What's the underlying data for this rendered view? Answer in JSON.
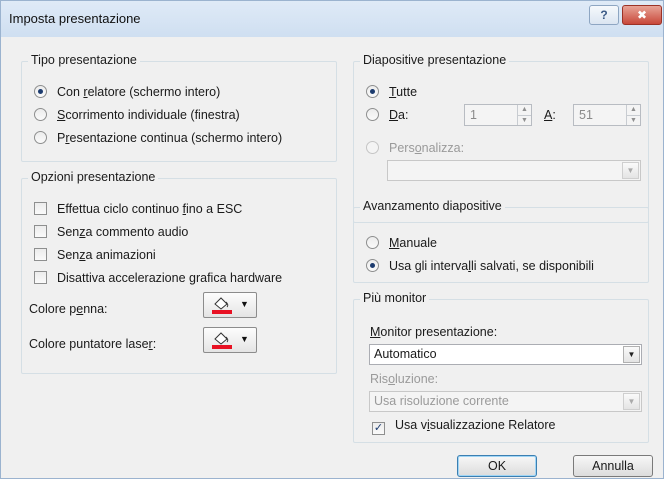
{
  "window": {
    "title": "Imposta presentazione",
    "help_glyph": "?",
    "close_glyph": "✖"
  },
  "tipo": {
    "legend": "Tipo presentazione",
    "options": [
      {
        "pre": "Con ",
        "ul": "r",
        "post": "elatore (schermo intero)",
        "selected": true
      },
      {
        "pre": "",
        "ul": "S",
        "post": "corrimento individuale (finestra)",
        "selected": false
      },
      {
        "pre": "P",
        "ul": "r",
        "post": "esentazione continua (schermo intero)",
        "selected": false
      }
    ]
  },
  "opzioni": {
    "legend": "Opzioni presentazione",
    "checks": [
      {
        "pre": "Effettua ciclo continuo ",
        "ul": "f",
        "post": "ino a ESC",
        "checked": false
      },
      {
        "pre": "Sen",
        "ul": "z",
        "post": "a commento audio",
        "checked": false
      },
      {
        "pre": "Sen",
        "ul": "z",
        "post": "a animazioni",
        "checked": false
      },
      {
        "pre": "Disattiva accelerazione ",
        "ul": "g",
        "post": "rafica hardware",
        "checked": false
      }
    ],
    "pen_color": {
      "pre": "Colore p",
      "ul": "e",
      "post": "nna:",
      "swatch": "#e81123"
    },
    "laser_color": {
      "pre": "Colore puntatore lase",
      "ul": "r",
      "post": ":",
      "swatch": "#e81123"
    }
  },
  "diapositive": {
    "legend": "Diapositive presentazione",
    "tutte": {
      "pre": "",
      "ul": "T",
      "post": "utte",
      "selected": true
    },
    "da": {
      "pre": "",
      "ul": "D",
      "post": "a:",
      "selected": false,
      "from_value": "1"
    },
    "a": {
      "pre": "",
      "ul": "A",
      "post": ":",
      "to_value": "51"
    },
    "personalizza": {
      "pre": "Pers",
      "ul": "o",
      "post": "nalizza:",
      "selected": false
    }
  },
  "avanzamento": {
    "legend": "Avanzamento diapositive",
    "options": [
      {
        "pre": "",
        "ul": "M",
        "post": "anuale",
        "selected": false
      },
      {
        "pre": "Usa gli interva",
        "ul": "l",
        "post": "li salvati, se disponibili",
        "selected": true
      }
    ]
  },
  "monitor": {
    "legend": "Più monitor",
    "monitor_label": {
      "pre": "",
      "ul": "M",
      "post": "onitor presentazione:"
    },
    "monitor_value": "Automatico",
    "risoluzione_label": {
      "pre": "Ris",
      "ul": "o",
      "post": "luzione:"
    },
    "risoluzione_value": "Usa risoluzione corrente",
    "relatore": {
      "pre": "Usa v",
      "ul": "i",
      "post": "sualizzazione Relatore",
      "checked": true
    }
  },
  "buttons": {
    "ok": "OK",
    "cancel": "Annulla"
  },
  "icons": {
    "dropdown": "▼",
    "spin_up": "▲",
    "spin_down": "▼",
    "check": "✓"
  }
}
